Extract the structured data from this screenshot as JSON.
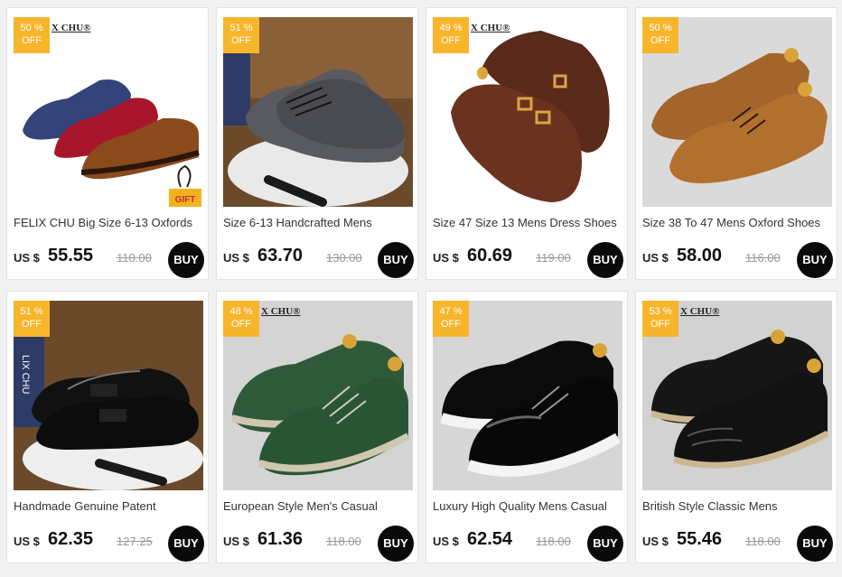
{
  "currency_label": "US $",
  "buy_label": "BUY",
  "products": [
    {
      "discount": "50 %",
      "off": "OFF",
      "brand": "X CHU®",
      "title": "FELIX CHU Big Size 6-13 Oxfords",
      "price": "55.55",
      "original_price": "110.00",
      "gift_label": "GIFT"
    },
    {
      "discount": "51 %",
      "off": "OFF",
      "title": "Size 6-13 Handcrafted Mens",
      "price": "63.70",
      "original_price": "130.00"
    },
    {
      "discount": "49 %",
      "off": "OFF",
      "brand": "X CHU®",
      "title": "Size 47 Size 13 Mens Dress Shoes",
      "price": "60.69",
      "original_price": "119.00"
    },
    {
      "discount": "50 %",
      "off": "OFF",
      "title": "Size 38 To 47 Mens Oxford Shoes",
      "price": "58.00",
      "original_price": "116.00"
    },
    {
      "discount": "51 %",
      "off": "OFF",
      "title": "Handmade Genuine Patent",
      "price": "62.35",
      "original_price": "127.25",
      "box_text": "LIX CHU"
    },
    {
      "discount": "48 %",
      "off": "OFF",
      "brand": "X CHU®",
      "title": "European Style Men's Casual",
      "price": "61.36",
      "original_price": "118.00"
    },
    {
      "discount": "47 %",
      "off": "OFF",
      "title": "Luxury High Quality Mens Casual",
      "price": "62.54",
      "original_price": "118.00"
    },
    {
      "discount": "53 %",
      "off": "OFF",
      "brand": "X CHU®",
      "title": "British Style Classic Mens",
      "price": "55.46",
      "original_price": "118.00"
    }
  ]
}
